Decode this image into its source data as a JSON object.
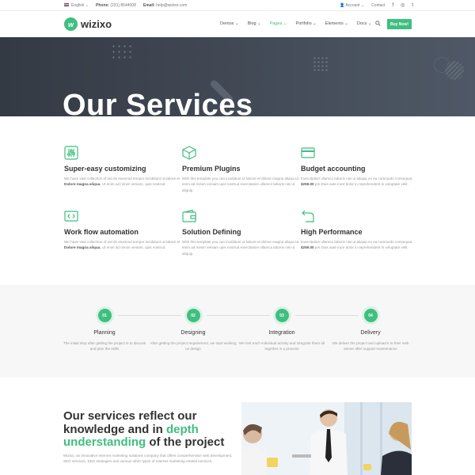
{
  "topbar": {
    "language": "English",
    "phone_label": "Phone:",
    "phone": "(231) 8544008",
    "email_label": "Email:",
    "email": "help@wizixo.com",
    "account": "Account",
    "contact": "Contact",
    "social": [
      "f",
      "◎",
      "t"
    ]
  },
  "nav": {
    "logo_mark": "w",
    "logo": "wizixo",
    "menu": [
      "Demos ⌄",
      "Blog ⌄",
      "Pages ⌄",
      "Portfolio ⌄",
      "Elements ⌄",
      "Docs ⌄"
    ],
    "active_menu": "Pages ⌄",
    "buy": "Buy Now!"
  },
  "hero": {
    "title": "Our Services"
  },
  "services": [
    {
      "icon": "sliders-icon",
      "title": "Super-easy customizing",
      "text_a": "We have vast collection of ied do eiusmod tempor incididunt ut labore et ",
      "bold": "Dolore magna aliqua.",
      "text_b": " Ut enim ad minim veniam, quis nostrud."
    },
    {
      "icon": "box-icon",
      "title": "Premium Plugins",
      "text_a": "With this template you can incididunt ut labore et dolore magna aliqua.Ut enim ad minim veniam quis nostrud exercitation ullamco laboris nisi ut aliquip.",
      "bold": "",
      "text_b": ""
    },
    {
      "icon": "credit-card-icon",
      "title": "Budget accounting",
      "text_a": "Exercitation ullamco laboris nisi ut aliquip ex ea commodo consequat. ",
      "bold": "$259.00",
      "text_b": " pm Duis aute irure dolor in reprehenderit in voluptate velit."
    },
    {
      "icon": "code-icon",
      "title": "Work flow automation",
      "text_a": "We have vast collection of ied do eiusmod tempor incididunt ut labore et ",
      "bold": "Dolore magna aliqua.",
      "text_b": " Ut enim ad minim veniam, quis nostrud."
    },
    {
      "icon": "wallet-icon",
      "title": "Solution Defining",
      "text_a": "With this template you can incididunt ut labore et dolore magna aliqua.Ut enim ad minim veniam quis nostrud exercitation ullamco laboris nisi ut aliquip.",
      "bold": "",
      "text_b": ""
    },
    {
      "icon": "return-icon",
      "title": "High Performance",
      "text_a": "Exercitation ullamco laboris nisi ut aliquip ex ea commodo consequat. ",
      "bold": "$259.00",
      "text_b": " pm Duis aute irure dolor in reprehenderit in voluptate velit."
    }
  ],
  "process": [
    {
      "num": "01",
      "title": "Planning",
      "text": "The initial step after getting the project is to discuss and plan the skills"
    },
    {
      "num": "02",
      "title": "Designing",
      "text": "After getting the project requirement, we start working on design"
    },
    {
      "num": "03",
      "title": "Integration",
      "text": "We test each individual activity and integrate them all together in a process"
    },
    {
      "num": "04",
      "title": "Delivery",
      "text": "We deliver the project and upload it to their web server after support maintenance"
    }
  ],
  "about": {
    "title_1": "Our services reflect our knowledge and in ",
    "title_green": "depth understanding",
    "title_2": " of the project",
    "text": "Wizixo, an innovative Internet marketing solutions company that offers comprehensive web development, SEO services, SEO strategies and various other types of Internet marketing related services."
  },
  "colors": {
    "accent": "#3fbf7f",
    "hero_dark": "#343a44"
  }
}
